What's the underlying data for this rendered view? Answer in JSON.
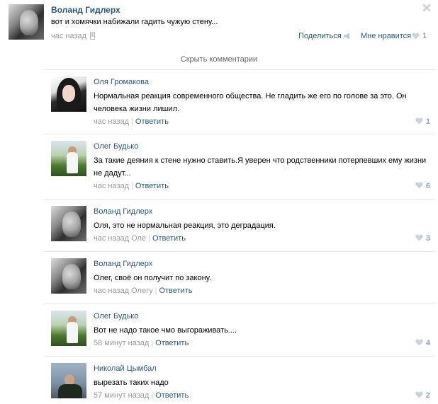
{
  "post": {
    "author": "Воланд Гидлерх",
    "text": "вот и хомячки набижали гадить чужую стену...",
    "time": "час назад",
    "share_label": "Поделиться",
    "like_label": "Мне нравится",
    "like_count": "1"
  },
  "hide_comments_label": "Скрыть комментарии",
  "colors": {
    "link": "#2b587a",
    "muted": "#999999",
    "like": "#8fa1b4"
  },
  "comments": [
    {
      "author": "Оля Громакова",
      "text": "Нормальная реакция современного общества. Не гладить же его по голове за это. Он человека жизни лишил.",
      "time": "час назад",
      "reply_label": "Ответить",
      "likes": "1"
    },
    {
      "author": "Олег Будько",
      "text": "За такие деяния к стене нужно ставить.Я уверен что родственники потерпевших ему жизни не дадут...",
      "time": "час назад",
      "reply_label": "Ответить",
      "likes": "6"
    },
    {
      "author": "Воланд Гидлерх",
      "text": "Оля, это не нормальная реакция, это деградация.",
      "time": "час назад Оле",
      "reply_label": "Ответить",
      "likes": "3"
    },
    {
      "author": "Воланд Гидлерх",
      "text": "Олег, своё он получит по закону.",
      "time": "час назад Олегу",
      "reply_label": "Ответить",
      "likes": ""
    },
    {
      "author": "Олег Будько",
      "text": "Вот не надо такое чмо выгораживать....",
      "time": "58 минут назад",
      "reply_label": "Ответить",
      "likes": "4"
    },
    {
      "author": "Николай Цымбал",
      "text": "вырезать таких надо",
      "time": "57 минут назад",
      "reply_label": "Ответить",
      "likes": "2"
    }
  ]
}
